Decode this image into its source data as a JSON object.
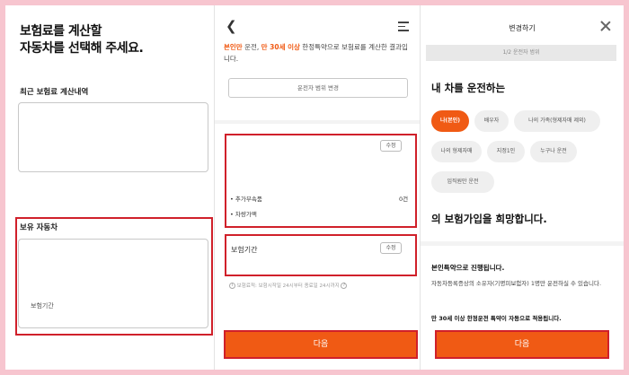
{
  "panel1": {
    "title_line1": "보험료를 계산할",
    "title_line2": "자동차를 선택해 주세요.",
    "recent_label": "최근 보험료 계산내역",
    "owned_label": "보유 자동차",
    "period_label": "보험기간"
  },
  "panel2": {
    "notice_p1": "본인만",
    "notice_p2": " 운전, ",
    "notice_p3": "만 30세 이상",
    "notice_p4": " 한정특약으로 보험료를 계산한 결과입니다.",
    "scope_button": "운전자 범위 변경",
    "edit_label": "수정",
    "extra_parts_label": "• 추가부속품",
    "extra_parts_count": "0건",
    "car_value_label": "• 차량가액",
    "period_title": "보험기간",
    "period_edit_label": "수정",
    "period_info": "보험료적: 보험시작일 24시부터 종료일 24시까지",
    "info_icon_glyph": "?",
    "next_label": "다음"
  },
  "panel3": {
    "header_title": "변경하기",
    "step_text": "1/2 운전자 범위",
    "question": "내 차를 운전하는",
    "chips": [
      "나(본인)",
      "배우자",
      "나의 가족(형제자매 제외)",
      "나의 형제자매",
      "지정1인",
      "누구나 운전",
      "임직원만 운전"
    ],
    "hope_text": "의 보험가입을 희망합니다.",
    "proceed_title": "본인특약으로 진행됩니다.",
    "proceed_desc": "자동차등록증상의 소유자(기명피보험자) 1명만 운전하실 수 있습니다.",
    "age_text": "만 30세 이상 한정운전 특약이 자동으로 적용됩니다.",
    "next_label": "다음"
  },
  "colors": {
    "accent": "#f05a14",
    "highlight": "#d0202a",
    "page_border": "#f7c5cf"
  },
  "icons": [
    "back-arrow-icon",
    "menu-icon",
    "info-icon",
    "close-icon"
  ]
}
